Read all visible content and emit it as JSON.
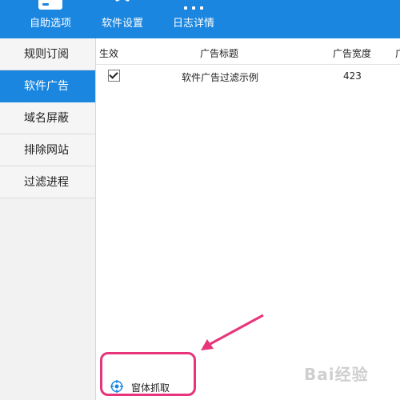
{
  "toolbar": {
    "items": [
      {
        "label": "自助选项",
        "icon": "self-service-icon"
      },
      {
        "label": "软件设置",
        "icon": "gear-icon"
      },
      {
        "label": "日志详情",
        "icon": "log-icon"
      }
    ]
  },
  "sidebar": {
    "items": [
      {
        "label": "规则订阅",
        "active": false
      },
      {
        "label": "软件广告",
        "active": true
      },
      {
        "label": "域名屏蔽",
        "active": false
      },
      {
        "label": "排除网站",
        "active": false
      },
      {
        "label": "过滤进程",
        "active": false
      }
    ]
  },
  "table": {
    "headers": {
      "enabled": "生效",
      "title": "广告标题",
      "width": "广告宽度",
      "extra": "广"
    },
    "rows": [
      {
        "checked": true,
        "title": "软件广告过滤示例",
        "width": "423"
      }
    ]
  },
  "capture": {
    "label": "窗体抓取",
    "icon": "crosshair-target-icon"
  },
  "watermark": {
    "text": "Bai经验"
  },
  "colors": {
    "accent": "#1a86e0",
    "highlight": "#e8347a"
  }
}
